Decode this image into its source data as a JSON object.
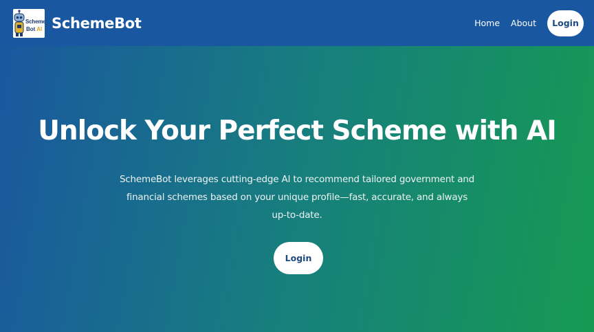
{
  "brand": {
    "name": "SchemeBot",
    "logo_line1": "Scheme",
    "logo_line2": "Bot",
    "logo_ai": "AI"
  },
  "nav": {
    "links": [
      "Home",
      "About"
    ],
    "login_label": "Login"
  },
  "hero": {
    "title": "Unlock Your Perfect Scheme with AI",
    "description": "SchemeBot leverages cutting-edge AI to recommend tailored government and financial schemes based on your unique profile—fast, accurate, and always up-to-date.",
    "login_label": "Login"
  },
  "colors": {
    "nav_bg": "#1957a0",
    "gradient_start": "#1a56a0",
    "gradient_end": "#169a52",
    "button_text": "#1c4a80"
  }
}
